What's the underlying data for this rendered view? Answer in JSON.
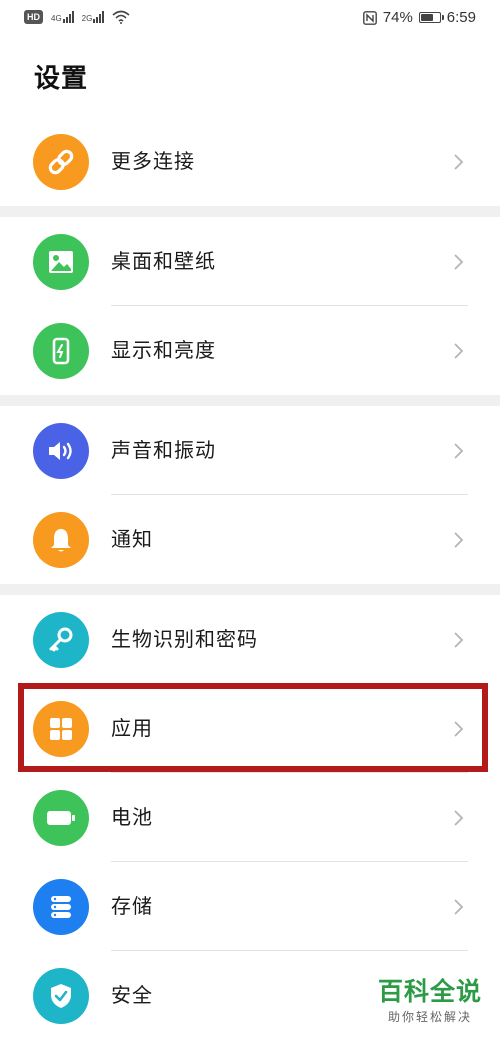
{
  "status_bar": {
    "hd": "HD",
    "net1": "4G",
    "net2": "2G",
    "battery_percent": "74%",
    "battery_level": 0.74,
    "time": "6:59"
  },
  "page_title": "设置",
  "items": [
    {
      "label": "更多连接",
      "icon": "link-icon",
      "color": "#f79a1f"
    },
    {
      "label": "桌面和壁纸",
      "icon": "wallpaper-icon",
      "color": "#3ec25a"
    },
    {
      "label": "显示和亮度",
      "icon": "display-icon",
      "color": "#3ec25a"
    },
    {
      "label": "声音和振动",
      "icon": "speaker-icon",
      "color": "#4a63e6"
    },
    {
      "label": "通知",
      "icon": "bell-icon",
      "color": "#f79a1f"
    },
    {
      "label": "生物识别和密码",
      "icon": "key-icon",
      "color": "#1fb5c8"
    },
    {
      "label": "应用",
      "icon": "apps-grid-icon",
      "color": "#f79a1f"
    },
    {
      "label": "电池",
      "icon": "battery-icon",
      "color": "#3ec25a"
    },
    {
      "label": "存储",
      "icon": "storage-icon",
      "color": "#1d7ff0"
    },
    {
      "label": "安全",
      "icon": "shield-icon",
      "color": "#1fb5c8"
    }
  ],
  "highlight_color": "#b31b1b",
  "watermark": {
    "title": "百科全说",
    "subtitle": "助你轻松解决",
    "color": "#2d9a46"
  }
}
